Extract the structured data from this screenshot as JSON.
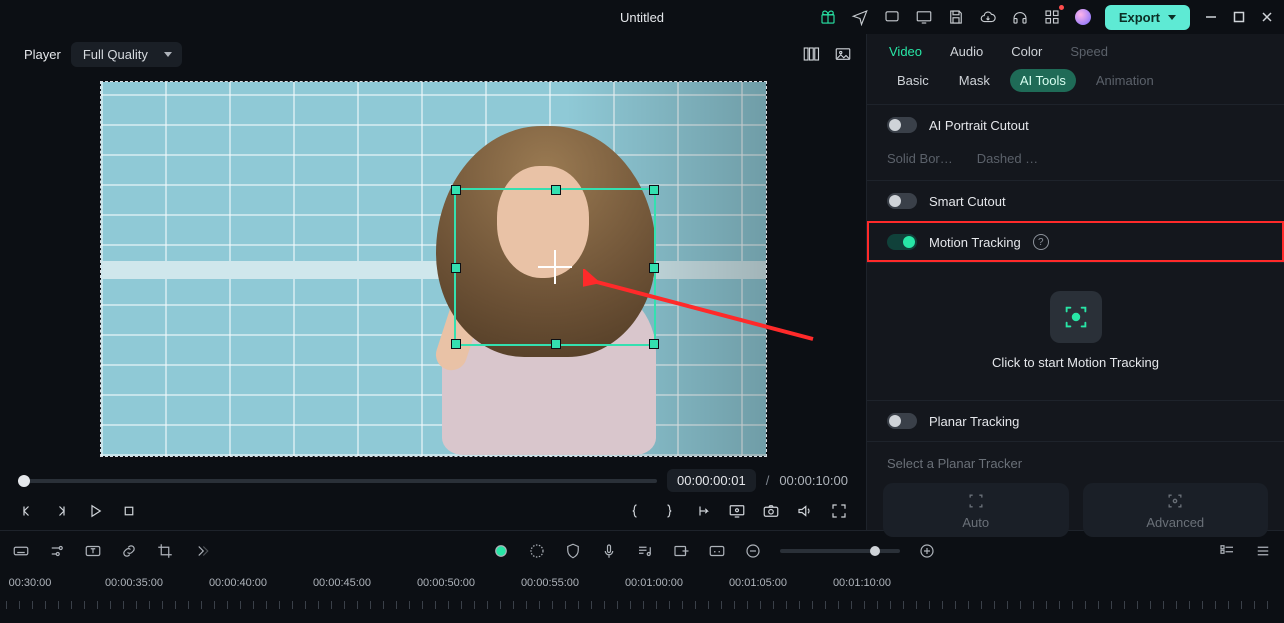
{
  "titlebar": {
    "title": "Untitled",
    "export_label": "Export"
  },
  "player": {
    "label": "Player",
    "quality": "Full Quality",
    "current_time": "00:00:00:01",
    "duration": "00:00:10:00"
  },
  "right_panel": {
    "main_tabs": {
      "video": "Video",
      "audio": "Audio",
      "color": "Color",
      "speed": "Speed"
    },
    "sub_tabs": {
      "basic": "Basic",
      "mask": "Mask",
      "ai_tools": "AI Tools",
      "animation": "Animation"
    },
    "ai_portrait": {
      "label": "AI Portrait Cutout",
      "on": false
    },
    "ghost_options": {
      "solid": "Solid Bor…",
      "dashed": "Dashed …"
    },
    "smart_cutout": {
      "label": "Smart Cutout",
      "on": false
    },
    "motion_tracking": {
      "label": "Motion Tracking",
      "on": true,
      "cta": "Click to start Motion Tracking"
    },
    "planar_tracking": {
      "label": "Planar Tracking",
      "on": false
    },
    "tracker_select_label": "Select a Planar Tracker",
    "tracker_cards": {
      "auto": "Auto",
      "advanced": "Advanced"
    }
  },
  "timeline": {
    "labels": [
      "00:30:00",
      "00:00:35:00",
      "00:00:40:00",
      "00:00:45:00",
      "00:00:50:00",
      "00:00:55:00",
      "00:01:00:00",
      "00:01:05:00",
      "00:01:10:00"
    ]
  }
}
